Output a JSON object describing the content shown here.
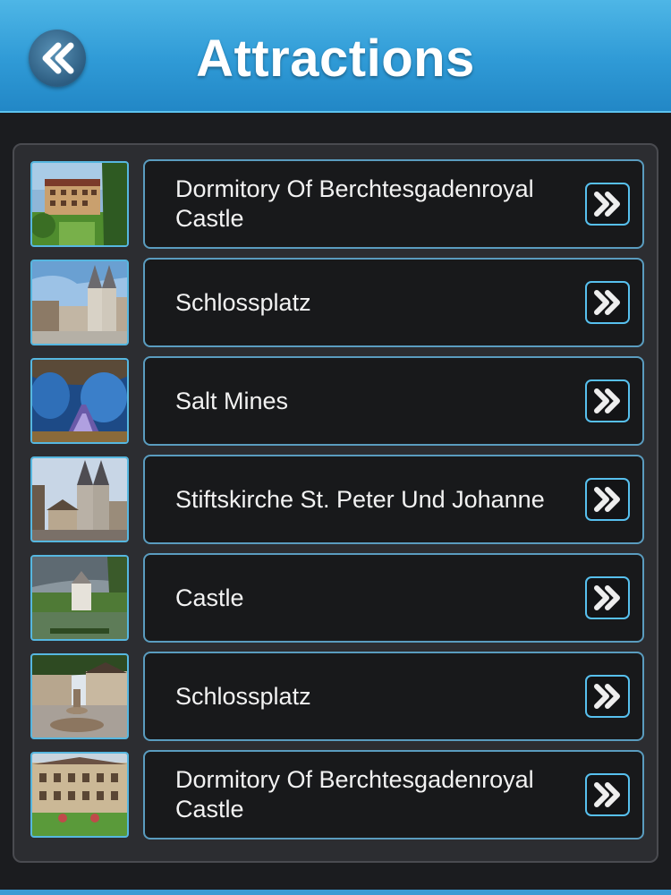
{
  "header": {
    "title": "Attractions",
    "back_icon": "double-chevron-left-icon",
    "color": "#2f9ad6"
  },
  "list": {
    "items": [
      {
        "label": "Dormitory Of Berchtesgadenroyal Castle",
        "thumb": "hotel-building-photo"
      },
      {
        "label": "Schlossplatz",
        "thumb": "church-towers-photo"
      },
      {
        "label": "Salt Mines",
        "thumb": "salt-mine-cave-photo"
      },
      {
        "label": "Stiftskirche St. Peter Und Johanne",
        "thumb": "church-square-photo"
      },
      {
        "label": "Castle",
        "thumb": "lake-castle-photo"
      },
      {
        "label": "Schlossplatz",
        "thumb": "fountain-square-photo"
      },
      {
        "label": "Dormitory Of Berchtesgadenroyal Castle",
        "thumb": "courtyard-building-photo"
      }
    ],
    "arrow_icon": "double-chevron-right-icon",
    "accent": "#57c0ee"
  }
}
